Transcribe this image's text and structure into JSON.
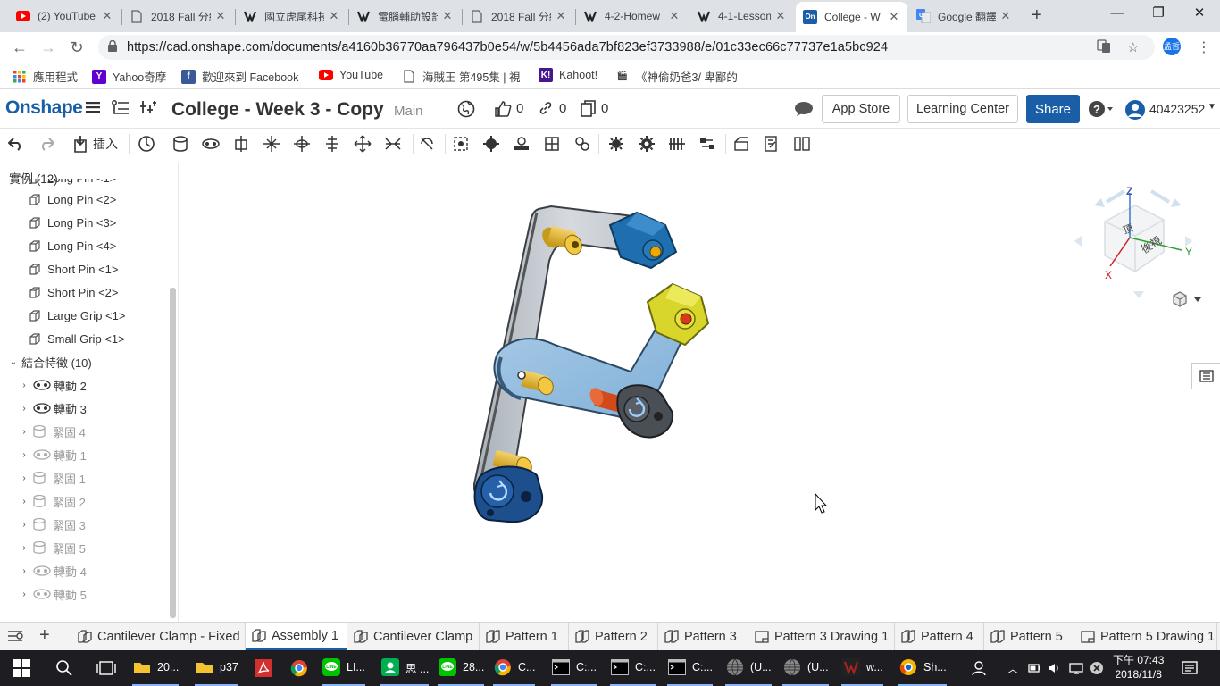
{
  "browser": {
    "tabs": [
      {
        "title": "(2) YouTube",
        "icon": "youtube-icon",
        "color": "#ff0000"
      },
      {
        "title": "2018 Fall 分組",
        "icon": "page-icon",
        "color": "#5f6368"
      },
      {
        "title": "國立虎尾科技",
        "icon": "gamepad-icon",
        "color": "#333333"
      },
      {
        "title": "電腦輔助設計",
        "icon": "gamepad-icon",
        "color": "#333333"
      },
      {
        "title": "2018 Fall 分組",
        "icon": "page-icon",
        "color": "#5f6368"
      },
      {
        "title": "4-2-Homew",
        "icon": "gamepad-icon",
        "color": "#333333"
      },
      {
        "title": "4-1-Lesson",
        "icon": "gamepad-icon",
        "color": "#333333"
      },
      {
        "title": "College - W",
        "icon": "onshape-icon",
        "color": "#1a5ea8",
        "fav_text": "On"
      },
      {
        "title": "Google 翻譯",
        "icon": "google-translate-icon",
        "color": "#4285f4"
      }
    ],
    "url": "https://cad.onshape.com/documents/a4160b36770aa796437b0e54/w/5b4456ada7bf823ef3733988/e/01c33ec66c77737e1a5bc924",
    "profile_initials": "孟哲",
    "bookmarks": [
      {
        "label": "應用程式",
        "icon": "apps-grid-icon",
        "color": "#4285f4"
      },
      {
        "label": "Yahoo奇摩",
        "icon": "yahoo-icon",
        "color": "#6001d2",
        "glyph": "Y"
      },
      {
        "label": "歡迎來到 Facebook",
        "icon": "facebook-icon",
        "color": "#3b5998",
        "glyph": "f"
      },
      {
        "label": "YouTube",
        "icon": "youtube-icon",
        "color": "#ff0000",
        "glyph": "▶"
      },
      {
        "label": "海賊王 第495集 | 視",
        "icon": "page-icon",
        "color": "#ffffff"
      },
      {
        "label": "Kahoot!",
        "icon": "kahoot-icon",
        "color": "#46178f",
        "glyph": "K!"
      },
      {
        "label": "《神偷奶爸3/ 卑鄙的",
        "icon": "clapper-icon",
        "color": "#333333",
        "glyph": "🎬"
      }
    ]
  },
  "onshape": {
    "logo": "Onshape",
    "document_title": "College - Week 3 - Copy",
    "branch": "Main",
    "likes": "0",
    "links": "0",
    "copies": "0",
    "app_store": "App Store",
    "learning_center": "Learning Center",
    "share": "Share",
    "user": "40423252",
    "insert_label": "插入"
  },
  "feature_tree": {
    "instances_header": "實例 (12)",
    "instances": [
      {
        "label": "Long Pin <1>"
      },
      {
        "label": "Long Pin <2>"
      },
      {
        "label": "Long Pin <3>"
      },
      {
        "label": "Long Pin <4>"
      },
      {
        "label": "Short Pin <1>"
      },
      {
        "label": "Short Pin <2>"
      },
      {
        "label": "Large Grip <1>"
      },
      {
        "label": "Small Grip <1>"
      }
    ],
    "mates_header": "結合特徵 (10)",
    "mates": [
      {
        "label": "轉動 2",
        "dim": false,
        "type": "revolute"
      },
      {
        "label": "轉動 3",
        "dim": false,
        "type": "revolute"
      },
      {
        "label": "緊固 4",
        "dim": true,
        "type": "fastened"
      },
      {
        "label": "轉動 1",
        "dim": true,
        "type": "revolute"
      },
      {
        "label": "緊固 1",
        "dim": true,
        "type": "fastened"
      },
      {
        "label": "緊固 2",
        "dim": true,
        "type": "fastened"
      },
      {
        "label": "緊固 3",
        "dim": true,
        "type": "fastened"
      },
      {
        "label": "緊固 5",
        "dim": true,
        "type": "fastened"
      },
      {
        "label": "轉動 4",
        "dim": true,
        "type": "revolute"
      },
      {
        "label": "轉動 5",
        "dim": true,
        "type": "revolute"
      }
    ]
  },
  "view_cube": {
    "top_face": "頂",
    "back_face": "後視",
    "axis_z": "Z",
    "axis_x": "X",
    "axis_y": "Y"
  },
  "bottom_tabs": [
    {
      "label": "Cantilever Clamp - Fixed",
      "type": "assembly",
      "active": false
    },
    {
      "label": "Assembly 1",
      "type": "assembly",
      "active": true
    },
    {
      "label": "Cantilever Clamp",
      "type": "assembly",
      "active": false
    },
    {
      "label": "Pattern 1",
      "type": "part",
      "active": false
    },
    {
      "label": "Pattern 2",
      "type": "part",
      "active": false
    },
    {
      "label": "Pattern 3",
      "type": "part",
      "active": false
    },
    {
      "label": "Pattern 3 Drawing 1",
      "type": "drawing",
      "active": false
    },
    {
      "label": "Pattern 4",
      "type": "part",
      "active": false
    },
    {
      "label": "Pattern 5",
      "type": "part",
      "active": false
    },
    {
      "label": "Pattern 5 Drawing 1",
      "type": "drawing",
      "active": false
    }
  ],
  "taskbar": {
    "items": [
      {
        "label": "20...",
        "icon": "explorer-folder-icon",
        "color": "#f4c430"
      },
      {
        "label": "p37",
        "icon": "explorer-folder-icon",
        "color": "#f4c430"
      },
      {
        "label": "",
        "icon": "acrobat-icon",
        "color": "#d32f2f"
      },
      {
        "label": "",
        "icon": "chrome-icon",
        "color": "#4caf50"
      },
      {
        "label": "LI...",
        "icon": "line-icon",
        "color": "#00c300"
      },
      {
        "label": "思 ...",
        "icon": "contact-icon",
        "color": "#00b050"
      },
      {
        "label": "28...",
        "icon": "line-icon",
        "color": "#00c300"
      },
      {
        "label": "C...",
        "icon": "chrome-icon",
        "color": "#4caf50"
      },
      {
        "label": "C:...",
        "icon": "cmd-icon",
        "color": "#000000"
      },
      {
        "label": "C:...",
        "icon": "cmd-icon",
        "color": "#000000"
      },
      {
        "label": "C:...",
        "icon": "cmd-icon",
        "color": "#000000"
      },
      {
        "label": "(U...",
        "icon": "sphere-icon",
        "color": "#666666"
      },
      {
        "label": "(U...",
        "icon": "sphere-icon",
        "color": "#666666"
      },
      {
        "label": "w...",
        "icon": "app-icon",
        "color": "#aa2222"
      },
      {
        "label": "Sh...",
        "icon": "chrome-canary-icon",
        "color": "#1565c0"
      }
    ],
    "time": "下午 07:43",
    "date": "2018/11/8"
  }
}
